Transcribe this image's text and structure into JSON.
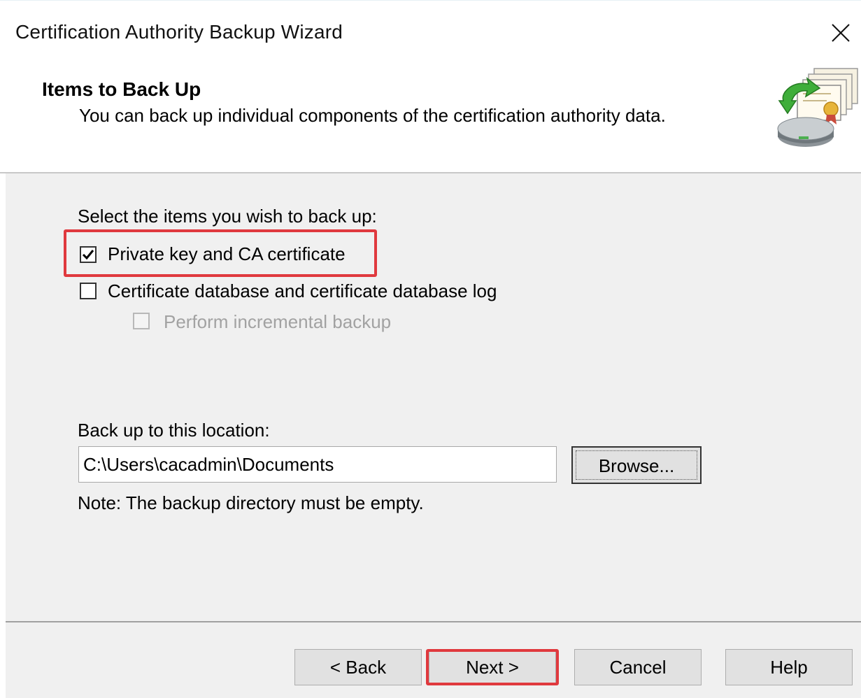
{
  "window": {
    "title": "Certification Authority Backup Wizard",
    "close_icon": "close-icon"
  },
  "header": {
    "title": "Items to Back Up",
    "subtitle": "You can back up individual components of the certification authority data.",
    "icon": "certificate-backup-icon"
  },
  "content": {
    "select_prompt": "Select the items you wish to back up:",
    "items": [
      {
        "label": "Private key and CA certificate",
        "checked": true,
        "enabled": true
      },
      {
        "label": "Certificate database and certificate database log",
        "checked": false,
        "enabled": true
      },
      {
        "label": "Perform incremental backup",
        "checked": false,
        "enabled": false
      }
    ],
    "location_label": "Back up to this location:",
    "location_value": "C:\\Users\\cacadmin\\Documents",
    "browse_label": "Browse...",
    "note": "Note: The backup directory must be empty."
  },
  "footer": {
    "back_label": "< Back",
    "next_label": "Next >",
    "cancel_label": "Cancel",
    "help_label": "Help"
  },
  "colors": {
    "highlight": "#e0393e",
    "panel": "#f0f0f0",
    "button": "#e1e1e1"
  }
}
